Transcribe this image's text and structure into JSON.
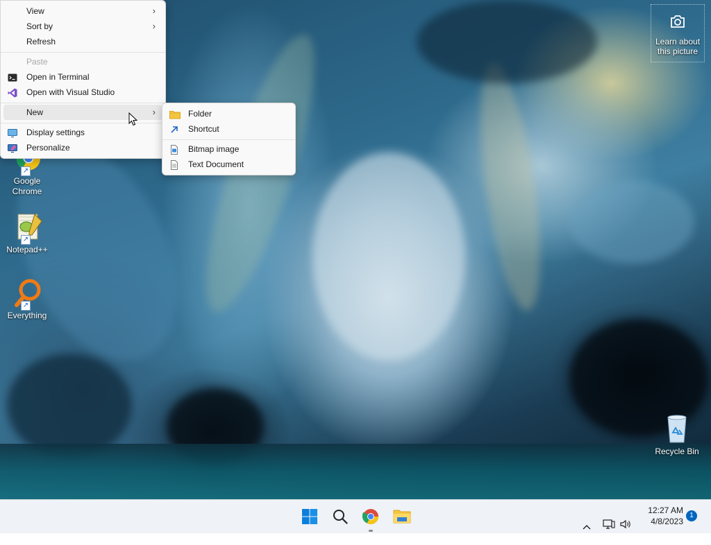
{
  "desktop": {
    "learn_picture": {
      "label": "Learn about this picture",
      "icon": "camera-icon"
    },
    "icons": [
      {
        "id": "chrome",
        "label": "Google Chrome",
        "icon": "chrome-icon"
      },
      {
        "id": "notepadpp",
        "label": "Notepad++",
        "icon": "notepadpp-icon"
      },
      {
        "id": "everything",
        "label": "Everything",
        "icon": "everything-icon"
      },
      {
        "id": "recycle",
        "label": "Recycle Bin",
        "icon": "recycle-bin-icon"
      }
    ]
  },
  "context_menu": {
    "view": "View",
    "sort_by": "Sort by",
    "refresh": "Refresh",
    "paste": "Paste",
    "open_terminal": "Open in Terminal",
    "open_vs": "Open with Visual Studio",
    "new": "New",
    "display_settings": "Display settings",
    "personalize": "Personalize"
  },
  "submenu_new": {
    "folder": "Folder",
    "shortcut": "Shortcut",
    "bitmap": "Bitmap image",
    "text_doc": "Text Document"
  },
  "taskbar": {
    "time": "12:27 AM",
    "date": "4/8/2023",
    "notification_count": "1",
    "apps": [
      "start-icon",
      "search-icon",
      "chrome-icon",
      "file-explorer-icon"
    ]
  },
  "colors": {
    "menu_bg": "#f9f9f9",
    "taskbar_bg": "#eff2f6",
    "accent": "#0067c0"
  }
}
